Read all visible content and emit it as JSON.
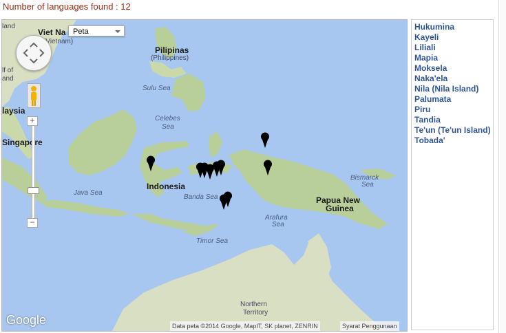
{
  "header": {
    "text": "Number of languages found : 12"
  },
  "map": {
    "maptype_label": "Peta",
    "google_logo": "Google",
    "attribution": "Data peta ©2014 Google, MapIT, SK planet, ZENRIN",
    "terms": "Syarat Penggunaan",
    "zoom_in": "+",
    "zoom_out": "−",
    "labels": {
      "vietnam": "Viet Na",
      "vietnam_sub": "(Vietnam)",
      "land_top": "land",
      "pilipinas": "Pilipinas",
      "philippines": "(Philippines)",
      "sulu_sea": "Sulu Sea",
      "celebes_sea_1": "Celebes",
      "celebes_sea_2": "Sea",
      "malaysia": "laysia",
      "gulf_1": "lf of",
      "gulf_2": "and",
      "singapore": "Singapore",
      "java_sea": "Java Sea",
      "indonesia": "Indonesia",
      "banda_sea": "Banda Sea",
      "arafura_1": "Arafura",
      "arafura_2": "Sea",
      "timor_sea": "Timor Sea",
      "bismarck_1": "Bismarck",
      "bismarck_2": "Sea",
      "png_1": "Papua New",
      "png_2": "Guinea",
      "nt_1": "Northern",
      "nt_2": "Territory"
    },
    "colors": {
      "water": "#a7c7f0",
      "land": "#d8dfc2",
      "forest": "#b8cf9a",
      "marker": "#000000"
    }
  },
  "languages": {
    "items": [
      "Hukumina",
      "Kayeli",
      "Liliali",
      "Mapia",
      "Moksela",
      "Naka'ela",
      "Nila (Nila Island)",
      "Palumata",
      "Piru",
      "Tandia",
      "Te'un (Te'un Island)",
      "Tobada'"
    ]
  }
}
